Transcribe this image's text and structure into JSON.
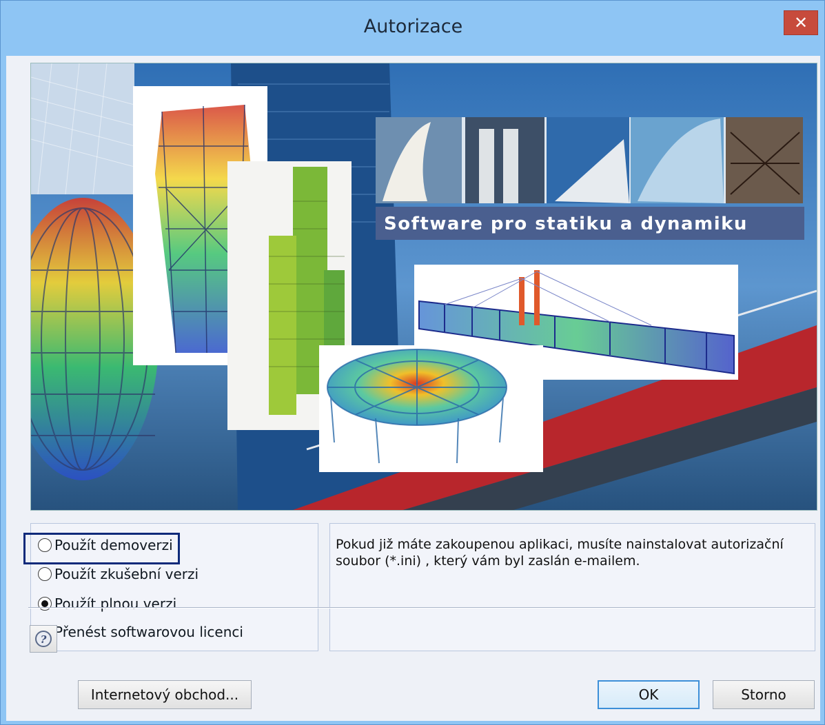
{
  "window": {
    "title": "Autorizace",
    "close_icon": "close-icon"
  },
  "banner": {
    "headline": "Software pro statiku a dynamiku"
  },
  "options": [
    {
      "label": "Použít demoverzi",
      "checked": false
    },
    {
      "label": "Použít zkušební verzi",
      "checked": false
    },
    {
      "label": "Použít plnou verzi",
      "checked": true
    },
    {
      "label": "Přenést softwarovou licenci",
      "checked": false
    }
  ],
  "info": {
    "text": "Pokud již máte zakoupenou aplikaci, musíte nainstalovat autorizační soubor (*.ini) , který vám byl zaslán e-mailem."
  },
  "buttons": {
    "help_icon": "help-icon",
    "shop_label": "Internetový obchod...",
    "ok_label": "OK",
    "cancel_label": "Storno"
  },
  "colors": {
    "titlebar": "#8ec5f4",
    "close": "#c74b3c",
    "headline_bg": "#4a5f8f"
  }
}
